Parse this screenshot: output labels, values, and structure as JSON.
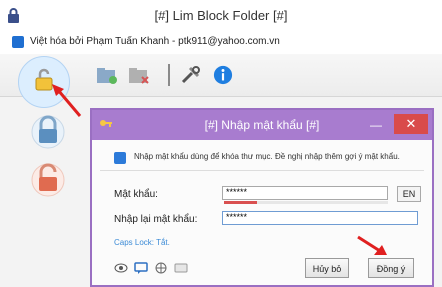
{
  "window": {
    "title": "[#] Lim Block Folder [#]"
  },
  "subbar": {
    "text": "Việt hóa bởi Phạm Tuấn Khanh - ptk911@yahoo.com.vn"
  },
  "toolbar": {
    "items": [
      "lock-folder",
      "add-folder",
      "remove-folder",
      "settings",
      "info"
    ]
  },
  "dialog": {
    "title": "[#] Nhập mật khẩu [#]",
    "info": "Nhập mật khẩu dùng để khóa thư mục. Đề nghị nhập thêm gợi ý mật khẩu.",
    "password_label": "Mật khẩu:",
    "password_value": "******",
    "confirm_label": "Nhập lại mật khẩu:",
    "confirm_value": "******",
    "lang_button": "EN",
    "caps_lock": "Caps Lock: Tắt.",
    "cancel_label": "Hủy bỏ",
    "ok_label": "Đồng ý",
    "strength": 0.2
  },
  "colors": {
    "dialog_title": "#a87ccf",
    "close_button": "#d94b4b",
    "arrow": "#e02020"
  }
}
